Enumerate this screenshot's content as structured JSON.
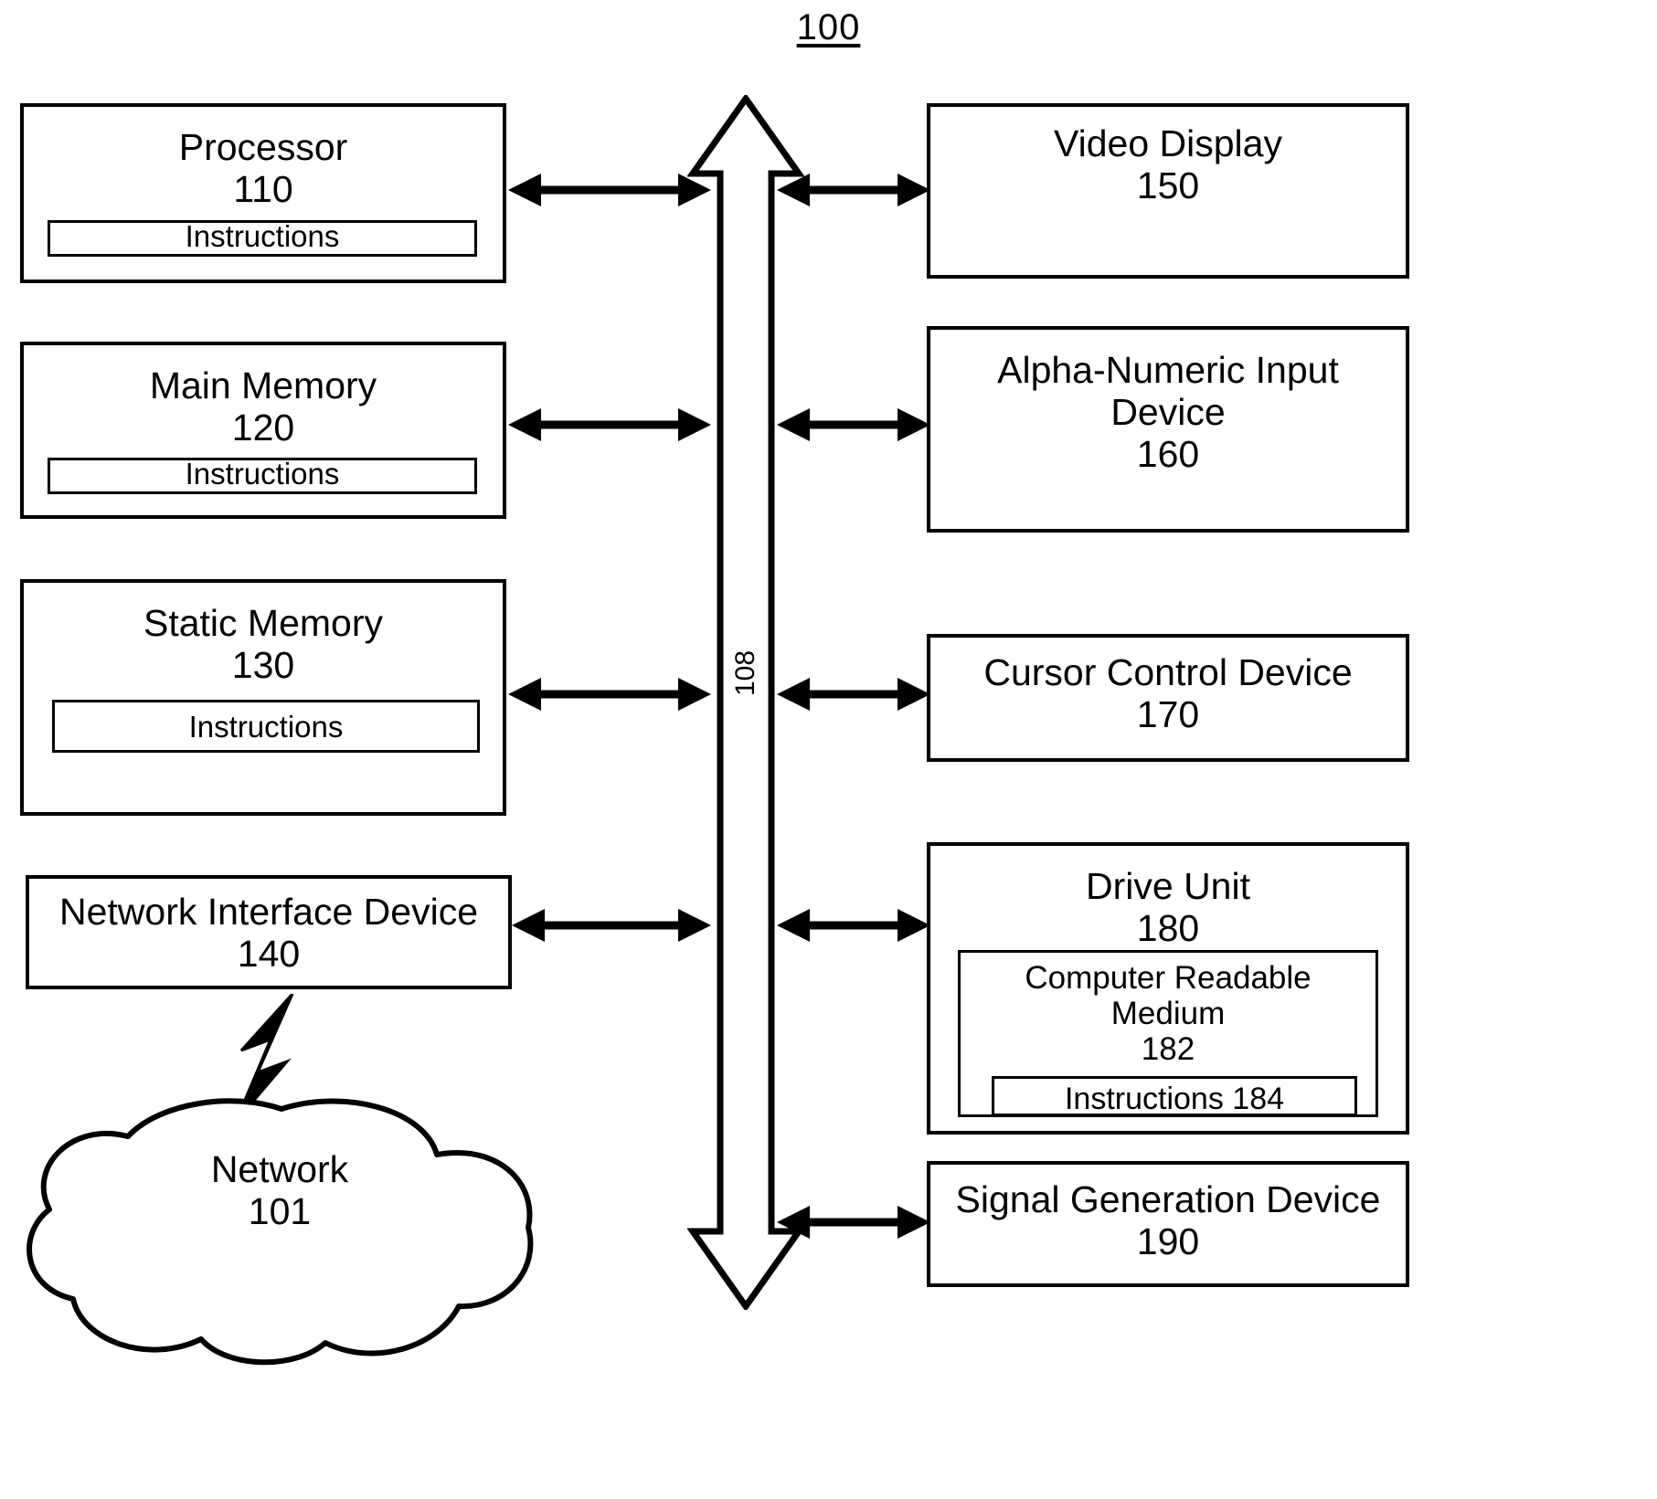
{
  "figure": {
    "number": "100",
    "bus_label": "108"
  },
  "left_column": {
    "blocks": [
      {
        "title": "Processor",
        "number": "110",
        "inner": {
          "label": "Instructions"
        }
      },
      {
        "title": "Main Memory",
        "number": "120",
        "inner": {
          "label": "Instructions"
        }
      },
      {
        "title": "Static Memory",
        "number": "130",
        "inner": {
          "label": "Instructions"
        }
      },
      {
        "title": "Network Interface Device",
        "number": "140",
        "inner": null
      }
    ],
    "cloud": {
      "title": "Network",
      "number": "101"
    }
  },
  "right_column": {
    "blocks": [
      {
        "title": "Video Display",
        "number": "150"
      },
      {
        "title_line1": "Alpha-Numeric Input",
        "title_line2": "Device",
        "number": "160"
      },
      {
        "title": "Cursor Control Device",
        "number": "170"
      },
      {
        "title": "Drive Unit",
        "number": "180",
        "inner": {
          "title_line1": "Computer Readable",
          "title_line2": "Medium",
          "number": "182",
          "inner": {
            "label": "Instructions 184"
          }
        }
      },
      {
        "title": "Signal Generation Device",
        "number": "190"
      }
    ]
  },
  "icons": {
    "bus": "double-headed-vertical-arrow-icon",
    "connector": "double-headed-horizontal-arrow-icon",
    "network_link": "lightning-bolt-icon",
    "cloud": "cloud-shape-icon"
  },
  "colors": {
    "stroke": "#000000",
    "background": "#ffffff"
  }
}
